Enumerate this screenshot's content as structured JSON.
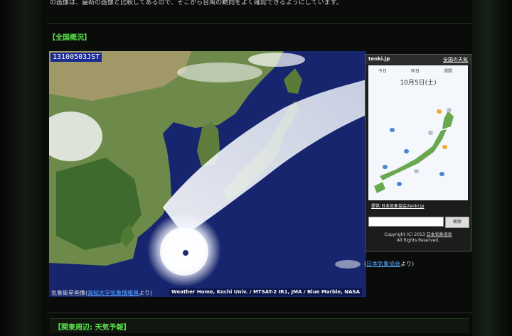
{
  "page": {
    "top_text": "の画像は、最新の画像と比較してあるので、そこから台風の動向をよく確認できるようにしています。"
  },
  "sections": {
    "overview_title": "【全国概況】",
    "kanto_title": "【関東周辺: 天気予報】"
  },
  "satellite": {
    "timestamp": "13100503JST",
    "credit": "Weather Home, Kochi Univ. / MTSAT-2 IR1, JMA / Blue Marble, NASA"
  },
  "caption": {
    "prefix": "気象衛星画像(",
    "link": "高知大学気象情報頁",
    "suffix": "より)"
  },
  "tenki_widget": {
    "brand": "tenki.jp",
    "all_link": "全国の天気",
    "tabs": [
      "今日",
      "明日",
      "週間"
    ],
    "date": "10月5日(土)",
    "link": "提供:日本気象協会/tenki.jp",
    "search_button": "検索",
    "copyright_line1": "Copyright (C) 2013",
    "copyright_link": "日本気象協会",
    "copyright_line2": "All Rights Reserved."
  },
  "jma_note": {
    "prefix": "(",
    "link": "日本気象協会",
    "suffix": "より)"
  },
  "colors": {
    "section_heading": "#58e04a",
    "link": "#5aa9ff",
    "stamp_bg": "#1a2c90"
  }
}
